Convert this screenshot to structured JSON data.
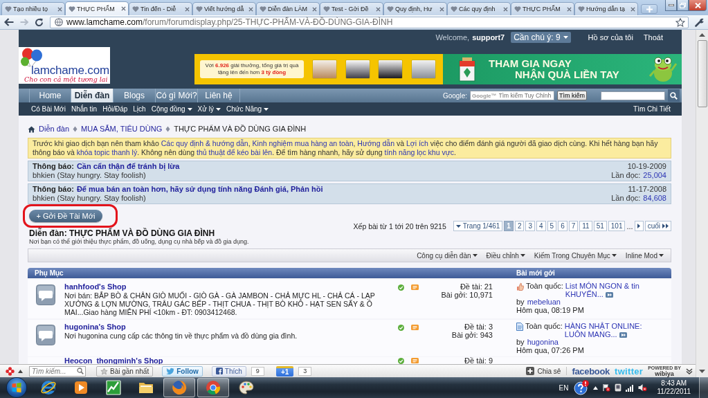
{
  "browser": {
    "tabs": [
      {
        "title": "Tạo nhiều tọ",
        "selected": false
      },
      {
        "title": "THỰC PHẨM",
        "selected": true
      },
      {
        "title": "Tin đến - Diễ",
        "selected": false
      },
      {
        "title": "Viết hướng dẫ",
        "selected": false
      },
      {
        "title": "Diễn đàn LÀM",
        "selected": false
      },
      {
        "title": "Test - Gởi Đề",
        "selected": false
      },
      {
        "title": "Quy định, Hư",
        "selected": false
      },
      {
        "title": "Các quy định",
        "selected": false
      },
      {
        "title": "THỰC PHẨM",
        "selected": false
      },
      {
        "title": "Hướng dẫn tạ",
        "selected": false
      }
    ],
    "address": {
      "host": "www.lamchame.com",
      "path": "/forum/forumdisplay.php/25-THỰC-PHẨM-VÀ-ĐỒ-DÙNG-GIA-ĐÌNH"
    }
  },
  "header": {
    "welcome": "Welcome,",
    "username": "support7",
    "alerts": "Cần chú ý: 9",
    "profile": "Hồ sơ của tôi",
    "logout": "Thoát",
    "logo": {
      "name": "lamchame.com",
      "tagline": "Cho con cả một tương lai"
    },
    "banner": {
      "offer": [
        {
          "text": "Với ",
          "highlight": false
        },
        {
          "text": "6.926",
          "highlight": true
        },
        {
          "text": " giải thưởng, tổng giá trị quà tặng lên đến hơn ",
          "highlight": false
        },
        {
          "text": "3 tỷ đồng",
          "highlight": true
        }
      ],
      "headline": [
        "THAM GIA NGAY",
        "NHẬN QUÀ LIỀN TAY"
      ]
    }
  },
  "nav": {
    "tabs": [
      {
        "label": "Home",
        "selected": false
      },
      {
        "label": "Diễn đàn",
        "selected": true
      },
      {
        "label": "Blogs",
        "selected": false
      },
      {
        "label": "Có gì Mới?",
        "selected": false
      },
      {
        "label": "Liên hệ",
        "selected": false
      }
    ],
    "google_label": "Google:",
    "google_mark": "Google™",
    "google_placeholder": "Tìm kiếm Tuy Chỉnh",
    "google_button": "Tìm kiếm"
  },
  "subnav": {
    "items": [
      {
        "label": "Có Bài Mới",
        "dropdown": false
      },
      {
        "label": "Nhắn tin",
        "dropdown": false
      },
      {
        "label": "Hỏi/Đáp",
        "dropdown": false
      },
      {
        "label": "Lịch",
        "dropdown": false
      },
      {
        "label": "Cộng đồng",
        "dropdown": true
      },
      {
        "label": "Xử lý",
        "dropdown": true
      },
      {
        "label": "Chức Năng",
        "dropdown": true
      }
    ],
    "advanced_search": "Tìm Chi Tiết"
  },
  "breadcrumb": [
    "Diễn đàn",
    "MUA SẮM, TIÊU DÙNG",
    "THỰC PHẨM VÀ ĐỒ DÙNG GIA ĐÌNH"
  ],
  "notice": [
    {
      "text": "Trước khi giao dịch bạn nên tham khảo ",
      "link": "Các quy định & hướng dẫn"
    },
    {
      "text": ", ",
      "link": "Kinh nghiệm mua hàng an toàn"
    },
    {
      "text": ", ",
      "link": "Hướng dẫn"
    },
    {
      "text": " và ",
      "link": "Lợi ích"
    },
    {
      "text": " việc cho điểm đánh giá người đã giao dịch cùng. Khi hết hàng bạn hãy thông báo và ",
      "link": "khóa topic thanh lý"
    },
    {
      "text": ". Không nên dùng ",
      "link": "thủ thuật để kéo bài lên"
    },
    {
      "text": ". Để tìm hàng nhanh, hãy sử dụng ",
      "link": "tính năng lọc khu vực"
    },
    {
      "text": "."
    }
  ],
  "announcements": [
    {
      "label": "Thông báo:",
      "title": "Cần cẩn thận để tránh bị lừa",
      "author": "bhkien (Stay hungry. Stay foolish)",
      "date": "10-19-2009",
      "views_label": "Lần đọc:",
      "views": "25,004"
    },
    {
      "label": "Thông báo:",
      "title": "Để mua bán an toàn hơn, hãy sử dụng tính năng Đánh giá, Phản hồi",
      "author": "bhkien (Stay hungry. Stay foolish)",
      "date": "11-17-2008",
      "views_label": "Lần đọc:",
      "views": "84,608"
    }
  ],
  "new_thread": {
    "label": "+ Gởi Đề Tài Mới",
    "circled": true
  },
  "forum": {
    "title": "Diễn đàn: THỰC PHẨM VÀ ĐỒ DÙNG GIA ĐÌNH",
    "description": "Nơi bạn có thể giới thiệu thực phẩm, đồ uống, dụng cụ nhà bếp và đồ gia dụng."
  },
  "pagination": {
    "summary": "Xếp bài từ 1 tới 20 trên 9215",
    "page_of": "Trang 1/461",
    "pages": [
      {
        "label": "1",
        "selected": true
      },
      {
        "label": "2",
        "selected": false
      },
      {
        "label": "3",
        "selected": false
      },
      {
        "label": "4",
        "selected": false
      },
      {
        "label": "5",
        "selected": false
      },
      {
        "label": "6",
        "selected": false
      },
      {
        "label": "7",
        "selected": false
      },
      {
        "label": "11",
        "selected": false
      },
      {
        "label": "51",
        "selected": false
      },
      {
        "label": "101",
        "selected": false
      }
    ],
    "ellipsis": "...",
    "last": "cuối"
  },
  "tools": [
    "Công cụ diễn đàn",
    "Điều chỉnh",
    "Kiếm Trong Chuyên Mục",
    "Inline Mod"
  ],
  "subforums": {
    "columns": [
      "Phụ Mục",
      "Bài mới gởi"
    ],
    "rows": [
      {
        "title": "hanhfood's Shop",
        "description": "Nơi bán: BẮP BÒ & CHÂN GIÒ MUỐI - GIÒ GÀ - GÀ JAMBON - CHẢ MỰC HL - CHẢ CÁ - LẠP XƯỞNG & LỢN MƯỜNG, TRÂU GÁC BẾP - THỊT CHUA - THỊT BÒ KHÔ - HẠT SEN SẤY & Ô MAI...Giao hàng MIỄN PHÍ <10km - ĐT: 0903412468.",
        "threads": "Đề tài: 21",
        "posts": "Bài gởi: 10,971",
        "last_post": {
          "kind": "thumb",
          "prefix": "Toàn quốc:",
          "title": "List MÓN NGON & tin KHUYẾN...",
          "by": "by",
          "author": "mebeluan",
          "time": "Hôm qua, 08:19 PM"
        }
      },
      {
        "title": "hugonina's Shop",
        "description": "Nơi hugonina cung cấp các thông tin về thực phẩm và đồ dùng gia đình.",
        "threads": "Đề tài: 3",
        "posts": "Bài gởi: 943",
        "last_post": {
          "kind": "doc",
          "prefix": "Toàn quốc:",
          "title": "HÀNG NHẬT ONLINE: LUÔN MANG...",
          "by": "by",
          "author": "hugonina",
          "time": "Hôm qua, 07:26 PM"
        }
      },
      {
        "title": "Heocon_thongminh's Shop",
        "threads": "Đề tài: 9"
      }
    ]
  },
  "social_bar": {
    "search_placeholder": "Tìm kiếm...",
    "recent": "Bài gần nhất",
    "follow": "Follow",
    "like": "Thích",
    "like_count": "9",
    "plus_one": "+1",
    "plus_count": "3",
    "share": "Chia sẻ",
    "facebook": "facebook",
    "twitter": "twitter",
    "powered_by": "POWERED BY",
    "brand": "wibiya"
  },
  "taskbar": {
    "apps": [
      {
        "kind": "ie",
        "active": false
      },
      {
        "kind": "media",
        "active": false
      },
      {
        "kind": "chart",
        "active": false
      },
      {
        "kind": "folder",
        "active": false
      },
      {
        "kind": "firefox",
        "active": true
      },
      {
        "kind": "chrome",
        "active": true
      },
      {
        "kind": "paint",
        "active": false
      }
    ],
    "language": "EN",
    "time": "8:43 AM",
    "date": "11/22/2011"
  }
}
